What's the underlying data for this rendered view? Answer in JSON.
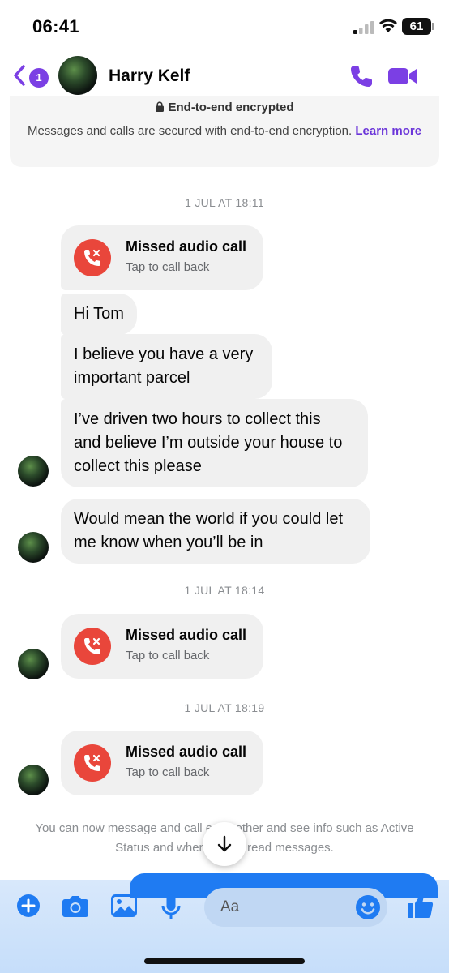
{
  "status_bar": {
    "time": "06:41",
    "battery": "61"
  },
  "header": {
    "back_count": "1",
    "contact_name": "Harry Kelf",
    "accent": "#7b3fe4"
  },
  "encryption": {
    "title": "End-to-end encrypted",
    "text": "Messages and calls are secured with end-to-end encryption.",
    "link": "Learn more"
  },
  "thread": {
    "ts1": "1 JUL AT 18:11",
    "call1": {
      "title": "Missed audio call",
      "sub": "Tap to call back"
    },
    "msg1": "Hi Tom",
    "msg2_l1": "I believe you have a very",
    "msg2_l2": "important parcel",
    "msg3_l1": "I’ve driven two hours to collect this",
    "msg3_l2": "and believe I’m outside your house to",
    "msg3_l3": "collect this please",
    "msg4_l1": "Would mean the world if you could let",
    "msg4_l2": "me know when you’ll be in",
    "ts2": "1 JUL AT 18:14",
    "call2": {
      "title": "Missed audio call",
      "sub": "Tap to call back"
    },
    "ts3": "1 JUL AT 18:19",
    "call3": {
      "title": "Missed audio call",
      "sub": "Tap to call back"
    }
  },
  "footer_note": {
    "line1": "You can now message and call each other and see info such as Active",
    "line2": "Status and when you've read messages."
  },
  "composer": {
    "placeholder": "Aa",
    "accent": "#1f7bf2"
  }
}
